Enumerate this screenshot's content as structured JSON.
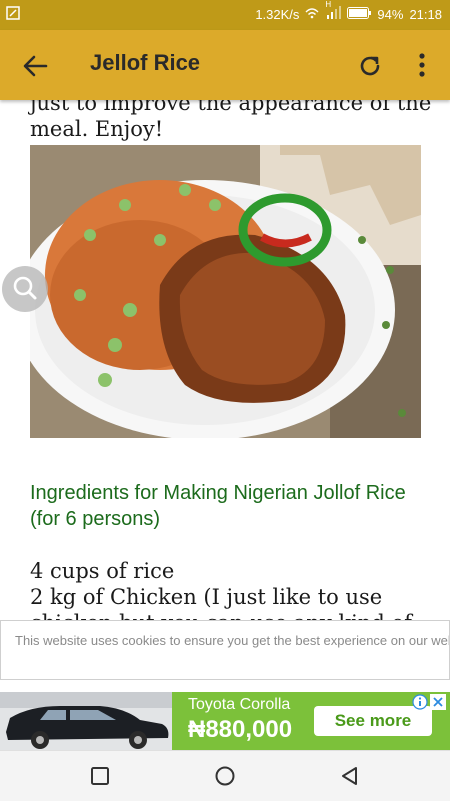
{
  "status_bar": {
    "network_speed": "1.32K/s",
    "battery": "94%",
    "time": "21:18",
    "signal_label": "H"
  },
  "toolbar": {
    "title": "Jellof Rice",
    "back_icon": "arrow-left-icon",
    "refresh_icon": "refresh-icon",
    "menu_icon": "more-vert-icon"
  },
  "article": {
    "intro_fragment": "just to improve the appearance of the meal. Enjoy!",
    "image_alt": "Jollof rice with chicken and pepper",
    "ingredients_heading": "Ingredients for Making Nigerian Jollof Rice (for 6 persons)",
    "ingredients": [
      "4 cups of rice",
      "2 kg of Chicken (I just like to use",
      "chicken but you can use any kind of"
    ]
  },
  "cookie_notice": {
    "text": "This website uses cookies to ensure you get the best experience on our website"
  },
  "ad": {
    "model": "Toyota Corolla",
    "price": "₦880,000",
    "cta": "See more"
  },
  "colors": {
    "toolbar": "#dcaa2a",
    "status_bar": "#bf9a18",
    "heading_green": "#1c6b1c",
    "ad_green": "#7cc13a"
  }
}
